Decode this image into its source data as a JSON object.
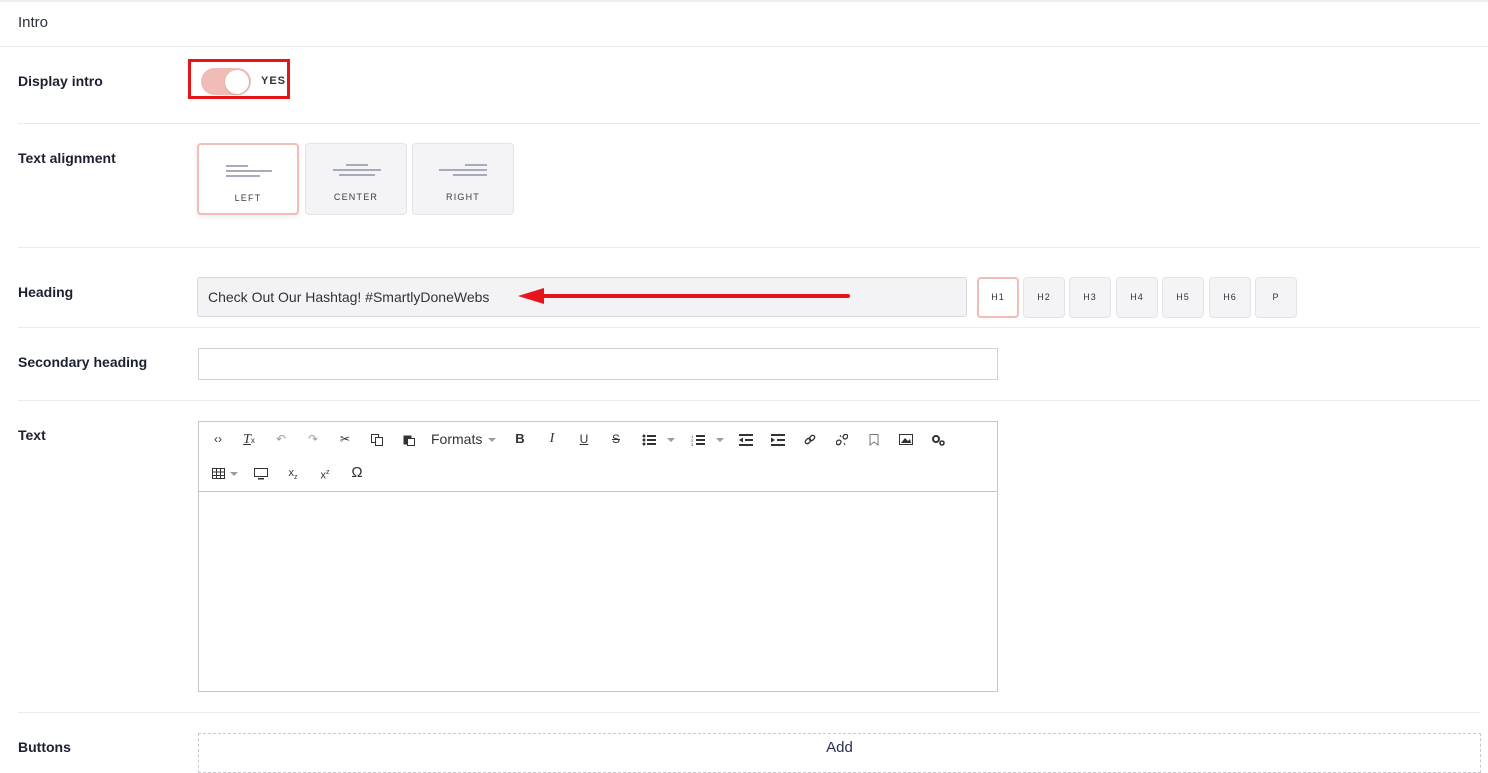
{
  "section": {
    "title": "Intro"
  },
  "display_intro": {
    "label": "Display intro",
    "toggle_state": "YES",
    "enabled": true,
    "highlight_color": "#e8141b"
  },
  "text_alignment": {
    "label": "Text alignment",
    "options": [
      {
        "caption": "LEFT",
        "selected": true
      },
      {
        "caption": "CENTER",
        "selected": false
      },
      {
        "caption": "RIGHT",
        "selected": false
      }
    ]
  },
  "heading": {
    "label": "Heading",
    "value": "Check Out Our Hashtag! #SmartlyDoneWebs",
    "levels": [
      "H1",
      "H2",
      "H3",
      "H4",
      "H5",
      "H6",
      "P"
    ],
    "selected_level": "H1",
    "annotation_color": "#e8141b"
  },
  "secondary_heading": {
    "label": "Secondary heading",
    "value": ""
  },
  "text": {
    "label": "Text",
    "toolbar": {
      "formats_label": "Formats",
      "row1_icons": [
        "code-icon",
        "clear-format-icon",
        "undo-icon",
        "redo-icon",
        "cut-icon",
        "copy-icon",
        "paste-icon",
        "formats-dropdown",
        "bold-icon",
        "italic-icon",
        "underline-icon",
        "strikethrough-icon",
        "bullet-list-icon",
        "numbered-list-icon",
        "outdent-icon",
        "indent-icon",
        "link-icon",
        "unlink-icon",
        "bookmark-icon",
        "image-icon",
        "settings-icon"
      ],
      "row2_icons": [
        "table-icon",
        "preview-icon",
        "subscript-icon",
        "superscript-icon",
        "omega-icon"
      ]
    }
  },
  "buttons": {
    "label": "Buttons",
    "add_label": "Add"
  },
  "colors": {
    "accent_border": "#f2bdb7",
    "toggle_track": "#f2bcb6"
  }
}
